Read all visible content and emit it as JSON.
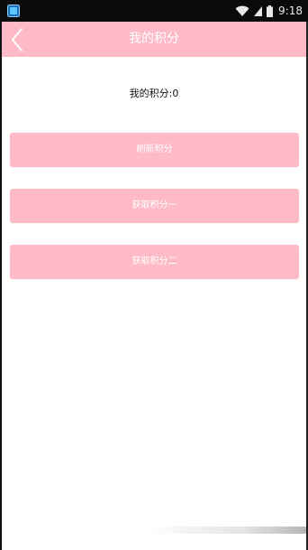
{
  "status_bar": {
    "time": "9:18",
    "app_icon": "app-icon",
    "wifi_icon": "wifi-icon",
    "signal_icon": "signal-icon",
    "battery_icon": "battery-icon"
  },
  "title_bar": {
    "title": "我的积分",
    "back_icon": "chevron-left-icon"
  },
  "content": {
    "points_text": "我的积分:0",
    "buttons": [
      {
        "label": "刷新积分"
      },
      {
        "label": "获取积分一"
      },
      {
        "label": "获取积分二"
      }
    ]
  },
  "colors": {
    "accent": "#ffbac7",
    "status_bar_bg": "#0b0b0b",
    "background": "#ffffff"
  }
}
